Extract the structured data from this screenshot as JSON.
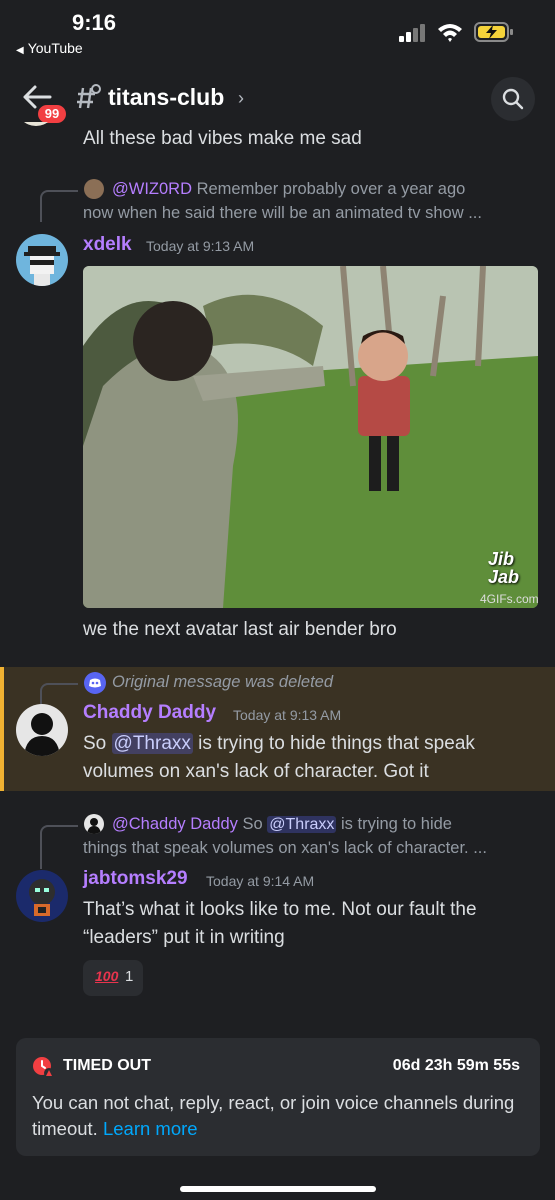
{
  "status": {
    "time": "9:16",
    "back_app": "YouTube"
  },
  "header": {
    "badge": "99",
    "channel": "titans-club",
    "chevron": "›"
  },
  "messages": {
    "prev_text": "All these bad vibes make me sad",
    "m1": {
      "reply_user": "@WIZ0RD",
      "reply_text_1": "Remember probably over a year ago",
      "reply_text_2": "now when he said there will be an animated tv show ...",
      "username": "xdelk",
      "timestamp": "Today at 9:13 AM",
      "gif_watermark_1": "Jib",
      "gif_watermark_2": "Jab",
      "gif_source": "4GIFs.com",
      "text": "we the next avatar last air bender bro"
    },
    "m2": {
      "reply_text": "Original message was deleted",
      "username": "Chaddy Daddy",
      "timestamp": "Today at 9:13 AM",
      "text_pre": "So",
      "mention": "@Thraxx",
      "text_post_1": "is trying to hide things that speak",
      "text_line2": "volumes on xan's lack of character.  Got it"
    },
    "m3": {
      "reply_user": "@Chaddy Daddy",
      "reply_pre": "So",
      "reply_mention": "@Thraxx",
      "reply_post": "is trying to hide",
      "reply_line2": "things that speak volumes on xan's lack of character. ...",
      "username": "jabtomsk29",
      "timestamp": "Today at 9:14 AM",
      "text_line1": "That’s what it looks like to me. Not our fault the",
      "text_line2": "“leaders” put it in writing",
      "reaction_emoji": "100",
      "reaction_count": "1"
    }
  },
  "timeout": {
    "title": "TIMED OUT",
    "timer": "06d 23h 59m 55s",
    "body": "You can not chat, reply, react, or join voice channels during timeout.",
    "link": "Learn more"
  },
  "colors": {
    "background": "#1e1f22",
    "username_purple": "#b57eff",
    "badge_red": "#f23f42",
    "highlight_bar": "#f0b232",
    "link_blue": "#00a8fc"
  }
}
